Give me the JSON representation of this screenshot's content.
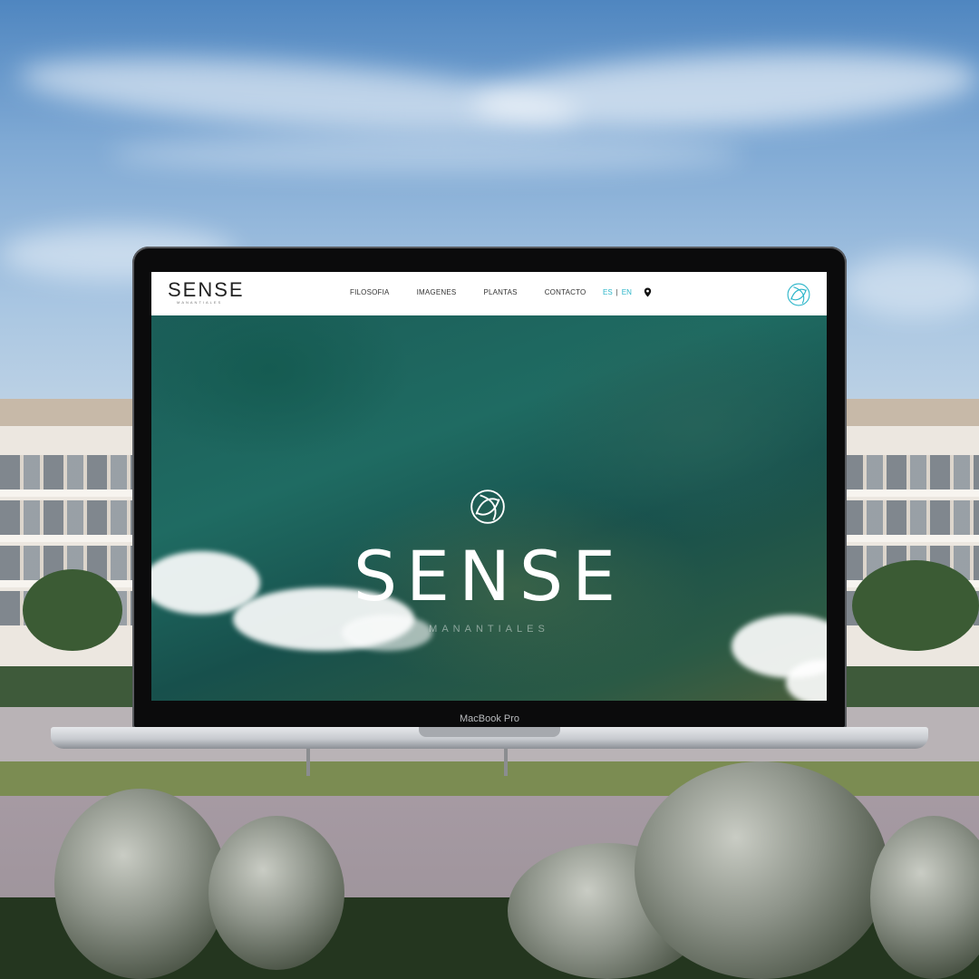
{
  "website": {
    "logo": {
      "word": "SENSE",
      "subword": "MANANTIALES"
    },
    "nav": [
      {
        "label": "FILOSOFIA"
      },
      {
        "label": "IMAGENES"
      },
      {
        "label": "PLANTAS"
      },
      {
        "label": "CONTACTO"
      }
    ],
    "languages": {
      "es": "ES",
      "separator": "|",
      "en": "EN"
    },
    "hero": {
      "title": "SENSE",
      "subtitle": "MANANTIALES"
    },
    "accent_color": "#2bb5c9",
    "icons": [
      "location-pin-icon",
      "sense-emblem-icon"
    ]
  },
  "device": {
    "label": "MacBook Pro"
  }
}
